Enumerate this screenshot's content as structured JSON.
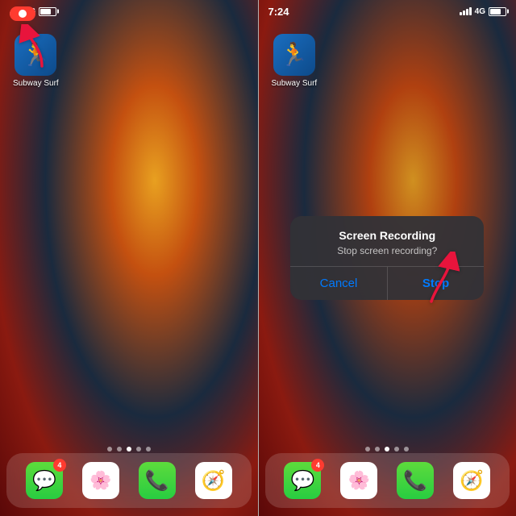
{
  "left_panel": {
    "app_name": "Subway Surf",
    "time": "",
    "recording_active": true,
    "page_dots": [
      0,
      1,
      2,
      3,
      4
    ],
    "active_dot": 2,
    "dock": {
      "icons": [
        "messages",
        "photos",
        "phone",
        "safari"
      ],
      "badge_count": "4"
    }
  },
  "right_panel": {
    "app_name": "Subway Surf",
    "time": "7:24",
    "page_dots": [
      0,
      1,
      2,
      3,
      4
    ],
    "active_dot": 2,
    "dock": {
      "icons": [
        "messages",
        "photos",
        "phone",
        "safari"
      ],
      "badge_count": "4"
    },
    "dialog": {
      "title": "Screen Recording",
      "message": "Stop screen recording?",
      "cancel_label": "Cancel",
      "stop_label": "Stop"
    }
  },
  "signal": "4G",
  "colors": {
    "red": "#ff3b30",
    "blue": "#007aff",
    "white": "#ffffff"
  }
}
